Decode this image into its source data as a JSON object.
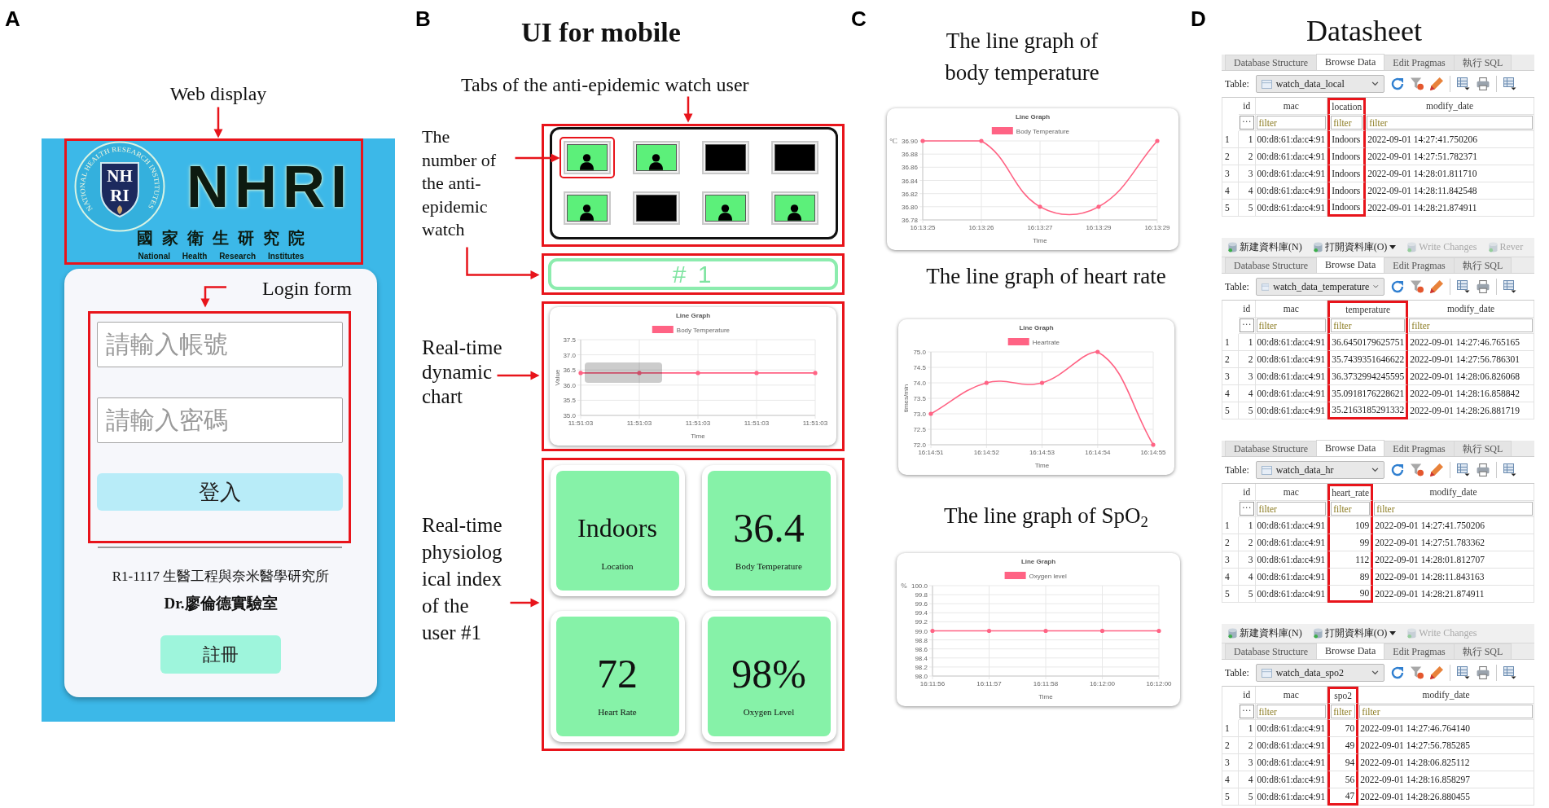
{
  "panel_a": {
    "letter": "A",
    "web_caption": "Web display",
    "header": {
      "seal_ring_text": "NATIONAL HEALTH RESEARCH INSTITUTES",
      "seal_letters": [
        "NH",
        "RI"
      ],
      "logo_text": "NHRI",
      "name_zh": "國家衛生研究院",
      "name_en": "National Health Research Institutes"
    },
    "login_caption": "Login form",
    "account_field": {
      "placeholder": "請輸入帳號"
    },
    "password_field": {
      "placeholder": "請輸入密碼"
    },
    "login_button": "登入",
    "address": "R1-1117 生醫工程與奈米醫學研究所",
    "lab": "Dr.廖倫德實驗室",
    "register_button": "註冊"
  },
  "panel_b": {
    "letter": "B",
    "title": "UI for mobile",
    "tabs_caption": "Tabs of the anti-epidemic watch user",
    "watch_caption": "The number of the anti-epidemic watch",
    "watches": [
      {
        "active": true,
        "selected": true
      },
      {
        "active": true,
        "selected": false
      },
      {
        "active": false,
        "selected": false
      },
      {
        "active": false,
        "selected": false
      },
      {
        "active": true,
        "selected": false
      },
      {
        "active": false,
        "selected": false
      },
      {
        "active": true,
        "selected": false
      },
      {
        "active": true,
        "selected": false
      }
    ],
    "user_number": "# 1",
    "chart_caption": "Real-time dynamic chart",
    "chart": {
      "tooltip_visible": true,
      "chart_data": {
        "type": "line",
        "title": "Line Graph",
        "xlabel": "Time",
        "ylabel": "Value",
        "grid": true,
        "categories": [
          "11:51:03",
          "11:51:03",
          "11:51:03",
          "11:51:03",
          "11:51:03"
        ],
        "ylim": [
          35,
          37.5
        ],
        "yticks": [
          {
            "value": 35,
            "label": "35.0"
          },
          {
            "value": 35.5,
            "label": "35.5"
          },
          {
            "value": 36,
            "label": "36.0"
          },
          {
            "value": 36.5,
            "label": "36.5"
          },
          {
            "value": 37,
            "label": "37.0"
          },
          {
            "value": 37.5,
            "label": "37.5"
          }
        ],
        "series": [
          {
            "name": "Body Temperature",
            "color": "#ff6384",
            "values": [
              36.4,
              36.4,
              36.4,
              36.4,
              36.4
            ]
          }
        ]
      }
    },
    "index_caption": "Real-time physiological index of the user #1",
    "cards": [
      {
        "kind": "text",
        "value": "Indoors",
        "label": "Location"
      },
      {
        "kind": "number",
        "value": "36.4",
        "label": "Body Temperature"
      },
      {
        "kind": "number",
        "value": "72",
        "label": "Heart Rate"
      },
      {
        "kind": "number",
        "value": "98%",
        "label": "Oxygen Level"
      }
    ]
  },
  "panel_c": {
    "letter": "C",
    "graphs": [
      {
        "caption": "The line graph of body temperature",
        "unit": "°C",
        "chart_data": {
          "type": "line",
          "title": "Line Graph",
          "xlabel": "Time",
          "grid": true,
          "categories": [
            "16:13:25",
            "16:13:26",
            "16:13:27",
            "16:13:29",
            "16:13:29"
          ],
          "ylim": [
            36.78,
            36.9
          ],
          "yticks": [
            {
              "value": 36.78,
              "label": "36.78"
            },
            {
              "value": 36.8,
              "label": "36.80"
            },
            {
              "value": 36.82,
              "label": "36.82"
            },
            {
              "value": 36.84,
              "label": "36.84"
            },
            {
              "value": 36.86,
              "label": "36.86"
            },
            {
              "value": 36.88,
              "label": "36.88"
            },
            {
              "value": 36.9,
              "label": "36.90"
            }
          ],
          "series": [
            {
              "name": "Body Temperature",
              "color": "#ff6384",
              "values": [
                36.9,
                36.9,
                36.8,
                36.8,
                36.9
              ]
            }
          ]
        }
      },
      {
        "caption": "The line graph of heart rate",
        "chart_data": {
          "type": "line",
          "title": "Line Graph",
          "xlabel": "Time",
          "ylabel": "times/min",
          "grid": true,
          "categories": [
            "16:14:51",
            "16:14:52",
            "16:14:53",
            "16:14:54",
            "16:14:55"
          ],
          "ylim": [
            72,
            75
          ],
          "yticks": [
            {
              "value": 72,
              "label": "72.0"
            },
            {
              "value": 72.5,
              "label": "72.5"
            },
            {
              "value": 73,
              "label": "73.0"
            },
            {
              "value": 73.5,
              "label": "73.5"
            },
            {
              "value": 74,
              "label": "74.0"
            },
            {
              "value": 74.5,
              "label": "74.5"
            },
            {
              "value": 75,
              "label": "75.0"
            }
          ],
          "series": [
            {
              "name": "Heartrate",
              "color": "#ff6384",
              "values": [
                73,
                74,
                74,
                75,
                72
              ]
            }
          ]
        }
      },
      {
        "caption": "The line graph of SpO$_{2}$",
        "unit": "%",
        "chart_data": {
          "type": "line",
          "title": "Line Graph",
          "xlabel": "Time",
          "grid": true,
          "categories": [
            "16:11:56",
            "16:11:57",
            "16:11:58",
            "16:12:00",
            "16:12:00"
          ],
          "ylim": [
            98,
            100
          ],
          "yticks": [
            {
              "value": 98,
              "label": "98.0"
            },
            {
              "value": 98.2,
              "label": "98.2"
            },
            {
              "value": 98.4,
              "label": "98.4"
            },
            {
              "value": 98.6,
              "label": "98.6"
            },
            {
              "value": 98.8,
              "label": "98.8"
            },
            {
              "value": 99,
              "label": "99.0"
            },
            {
              "value": 99.2,
              "label": "99.2"
            },
            {
              "value": 99.4,
              "label": "99.4"
            },
            {
              "value": 99.6,
              "label": "99.6"
            },
            {
              "value": 99.8,
              "label": "99.8"
            },
            {
              "value": 100,
              "label": "100.0"
            }
          ],
          "series": [
            {
              "name": "Oxygen level",
              "color": "#ff6384",
              "values": [
                99,
                99,
                99,
                99,
                99
              ]
            }
          ]
        }
      }
    ]
  },
  "panel_d": {
    "letter": "D",
    "title": "Datasheet",
    "tables": [
      {
        "tabs": [
          {
            "label": "Database Structure",
            "selected": false
          },
          {
            "label": "Browse Data",
            "selected": true
          },
          {
            "label": "Edit Pragmas",
            "selected": false
          },
          {
            "label": "執行 SQL",
            "selected": false
          }
        ],
        "table_label": "Table:",
        "table_name": "watch_data_local",
        "columns": [
          {
            "name": "id",
            "kind": "number",
            "highlighted": false
          },
          {
            "name": "mac",
            "kind": "text",
            "highlighted": false
          },
          {
            "name": "location",
            "kind": "text",
            "highlighted": true
          },
          {
            "name": "modify_date",
            "kind": "text",
            "highlighted": false
          }
        ],
        "filter_menu": "···",
        "filter_fields": [
          {
            "placeholder": "filter"
          },
          {
            "placeholder": "filter"
          },
          {
            "placeholder": "filter"
          }
        ],
        "rows": [
          {
            "number": "1",
            "cells": [
              "1",
              "00:d8:61:da:c4:91",
              "Indoors",
              "2022-09-01 14:27:41.750206"
            ]
          },
          {
            "number": "2",
            "cells": [
              "2",
              "00:d8:61:da:c4:91",
              "Indoors",
              "2022-09-01 14:27:51.782371"
            ]
          },
          {
            "number": "3",
            "cells": [
              "3",
              "00:d8:61:da:c4:91",
              "Indoors",
              "2022-09-01 14:28:01.811710"
            ]
          },
          {
            "number": "4",
            "cells": [
              "4",
              "00:d8:61:da:c4:91",
              "Indoors",
              "2022-09-01 14:28:11.842548"
            ]
          },
          {
            "number": "5",
            "cells": [
              "5",
              "00:d8:61:da:c4:91",
              "Indoors",
              "2022-09-01 14:28:21.874911"
            ]
          }
        ]
      },
      {
        "menu": [
          {
            "label": "新建資料庫(N)",
            "disabled": false,
            "dropdown": false
          },
          {
            "label": "打開資料庫(O)",
            "disabled": false,
            "dropdown": true
          },
          {
            "label": "Write Changes",
            "disabled": true,
            "dropdown": false
          },
          {
            "label": "Rever",
            "disabled": true,
            "dropdown": false
          }
        ],
        "tabs": [
          {
            "label": "Database Structure",
            "selected": false
          },
          {
            "label": "Browse Data",
            "selected": true
          },
          {
            "label": "Edit Pragmas",
            "selected": false
          },
          {
            "label": "執行 SQL",
            "selected": false
          }
        ],
        "table_label": "Table:",
        "table_name": "watch_data_temperature",
        "columns": [
          {
            "name": "id",
            "kind": "number",
            "highlighted": false
          },
          {
            "name": "mac",
            "kind": "text",
            "highlighted": false
          },
          {
            "name": "temperature",
            "kind": "number",
            "highlighted": true
          },
          {
            "name": "modify_date",
            "kind": "text",
            "highlighted": false
          }
        ],
        "filter_menu": "···",
        "filter_fields": [
          {
            "placeholder": "filter"
          },
          {
            "placeholder": "filter"
          },
          {
            "placeholder": "filter"
          }
        ],
        "rows": [
          {
            "number": "1",
            "cells": [
              "1",
              "00:d8:61:da:c4:91",
              "36.6450179625751",
              "2022-09-01 14:27:46.765165"
            ]
          },
          {
            "number": "2",
            "cells": [
              "2",
              "00:d8:61:da:c4:91",
              "35.7439351646622",
              "2022-09-01 14:27:56.786301"
            ]
          },
          {
            "number": "3",
            "cells": [
              "3",
              "00:d8:61:da:c4:91",
              "36.3732994245595",
              "2022-09-01 14:28:06.826068"
            ]
          },
          {
            "number": "4",
            "cells": [
              "4",
              "00:d8:61:da:c4:91",
              "35.0918176228621",
              "2022-09-01 14:28:16.858842"
            ]
          },
          {
            "number": "5",
            "cells": [
              "5",
              "00:d8:61:da:c4:91",
              "35.2163185291332",
              "2022-09-01 14:28:26.881719"
            ]
          }
        ]
      },
      {
        "tabs": [
          {
            "label": "Database Structure",
            "selected": false
          },
          {
            "label": "Browse Data",
            "selected": true
          },
          {
            "label": "Edit Pragmas",
            "selected": false
          },
          {
            "label": "執行 SQL",
            "selected": false
          }
        ],
        "table_label": "Table:",
        "table_name": "watch_data_hr",
        "columns": [
          {
            "name": "id",
            "kind": "number",
            "highlighted": false
          },
          {
            "name": "mac",
            "kind": "text",
            "highlighted": false
          },
          {
            "name": "heart_rate",
            "kind": "number",
            "highlighted": true
          },
          {
            "name": "modify_date",
            "kind": "text",
            "highlighted": false
          }
        ],
        "filter_menu": "···",
        "filter_fields": [
          {
            "placeholder": "filter"
          },
          {
            "placeholder": "filter"
          },
          {
            "placeholder": "filter"
          }
        ],
        "rows": [
          {
            "number": "1",
            "cells": [
              "1",
              "00:d8:61:da:c4:91",
              "109",
              "2022-09-01 14:27:41.750206"
            ]
          },
          {
            "number": "2",
            "cells": [
              "2",
              "00:d8:61:da:c4:91",
              "99",
              "2022-09-01 14:27:51.783362"
            ]
          },
          {
            "number": "3",
            "cells": [
              "3",
              "00:d8:61:da:c4:91",
              "112",
              "2022-09-01 14:28:01.812707"
            ]
          },
          {
            "number": "4",
            "cells": [
              "4",
              "00:d8:61:da:c4:91",
              "89",
              "2022-09-01 14:28:11.843163"
            ]
          },
          {
            "number": "5",
            "cells": [
              "5",
              "00:d8:61:da:c4:91",
              "90",
              "2022-09-01 14:28:21.874911"
            ]
          }
        ]
      },
      {
        "menu": [
          {
            "label": "新建資料庫(N)",
            "disabled": false,
            "dropdown": false
          },
          {
            "label": "打開資料庫(O)",
            "disabled": false,
            "dropdown": true
          },
          {
            "label": "Write Changes",
            "disabled": true,
            "dropdown": false
          }
        ],
        "tabs": [
          {
            "label": "Database Structure",
            "selected": false
          },
          {
            "label": "Browse Data",
            "selected": true
          },
          {
            "label": "Edit Pragmas",
            "selected": false
          },
          {
            "label": "執行 SQL",
            "selected": false
          }
        ],
        "table_label": "Table:",
        "table_name": "watch_data_spo2",
        "columns": [
          {
            "name": "id",
            "kind": "number",
            "highlighted": false
          },
          {
            "name": "mac",
            "kind": "text",
            "highlighted": false
          },
          {
            "name": "spo2",
            "kind": "number",
            "highlighted": true
          },
          {
            "name": "modify_date",
            "kind": "text",
            "highlighted": false
          }
        ],
        "filter_menu": "···",
        "filter_fields": [
          {
            "placeholder": "filter"
          },
          {
            "placeholder": "filter"
          },
          {
            "placeholder": "filter"
          }
        ],
        "rows": [
          {
            "number": "1",
            "cells": [
              "1",
              "00:d8:61:da:c4:91",
              "70",
              "2022-09-01 14:27:46.764140"
            ]
          },
          {
            "number": "2",
            "cells": [
              "2",
              "00:d8:61:da:c4:91",
              "49",
              "2022-09-01 14:27:56.785285"
            ]
          },
          {
            "number": "3",
            "cells": [
              "3",
              "00:d8:61:da:c4:91",
              "94",
              "2022-09-01 14:28:06.825112"
            ]
          },
          {
            "number": "4",
            "cells": [
              "4",
              "00:d8:61:da:c4:91",
              "56",
              "2022-09-01 14:28:16.858297"
            ]
          },
          {
            "number": "5",
            "cells": [
              "5",
              "00:d8:61:da:c4:91",
              "47",
              "2022-09-01 14:28:26.880455"
            ]
          }
        ]
      }
    ]
  }
}
